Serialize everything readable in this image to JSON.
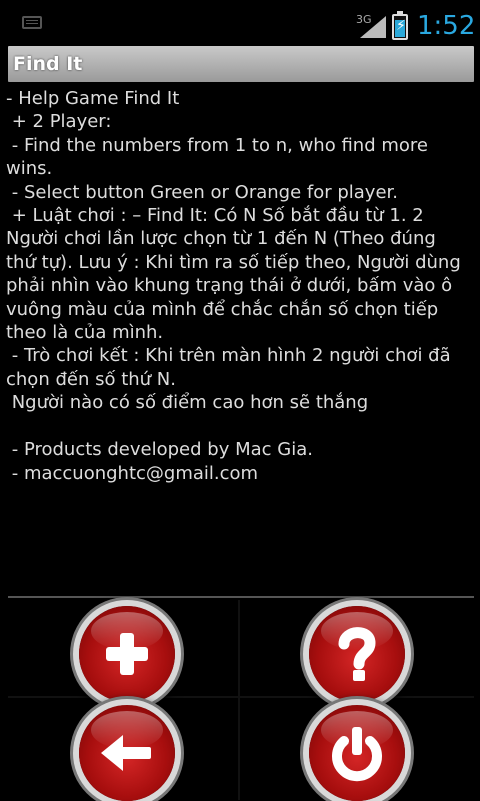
{
  "status_bar": {
    "network": "3G",
    "time": "1:52",
    "icons": [
      "keyboard-icon",
      "signal-icon",
      "battery-charging-icon"
    ]
  },
  "title": "Find It",
  "help_lines": [
    "- Help Game Find It",
    " + 2 Player:",
    " - Find the numbers from 1 to n, who find more",
    "wins.",
    " - Select button Green or Orange for player.",
    " + Luật chơi : – Find It: Có N Số bắt đầu từ 1. 2",
    "Người chơi lần lược chọn từ 1 đến N (Theo đúng",
    "thứ tự). Lưu ý : Khi tìm ra số tiếp theo, Người dùng",
    "phải nhìn vào khung trạng thái ở dưới, bấm vào ô",
    "vuông màu của mình để chắc chắn số chọn tiếp",
    "theo là của mình.",
    " - Trò chơi kết : Khi trên màn hình 2 người chơi đã",
    "chọn đến số thứ N.",
    " Người nào có số điểm cao hơn sẽ thắng",
    "",
    " - Products developed by Mac Gia.",
    " - maccuonghtc@gmail.com"
  ],
  "buttons": [
    {
      "name": "new-game-button",
      "icon": "plus-icon"
    },
    {
      "name": "help-button",
      "icon": "question-icon"
    },
    {
      "name": "back-button",
      "icon": "back-arrow-icon"
    },
    {
      "name": "exit-button",
      "icon": "power-icon"
    }
  ],
  "colors": {
    "accent_clock": "#2aa8e0",
    "button_red": "#c21818",
    "title_bar": "#b0b0b0"
  }
}
